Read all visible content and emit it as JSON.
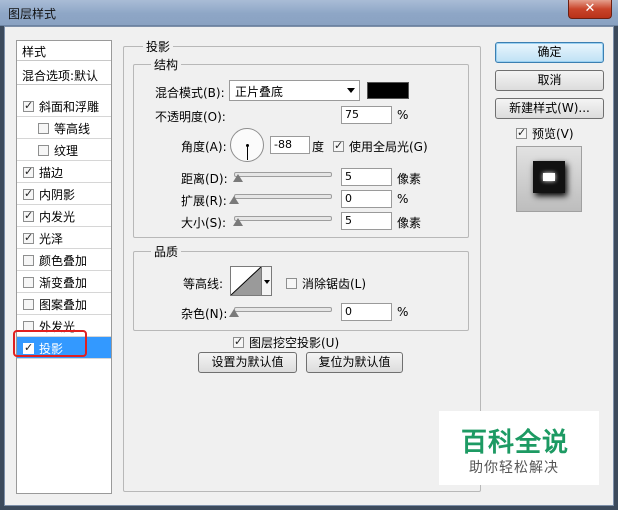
{
  "window": {
    "title": "图层样式",
    "close_label": "✕"
  },
  "style_list": {
    "header": "样式",
    "blend_options": "混合选项:默认",
    "items": [
      {
        "label": "斜面和浮雕",
        "checked": true,
        "sub": false
      },
      {
        "label": "等高线",
        "checked": false,
        "sub": true
      },
      {
        "label": "纹理",
        "checked": false,
        "sub": true
      },
      {
        "label": "描边",
        "checked": true,
        "sub": false
      },
      {
        "label": "内阴影",
        "checked": true,
        "sub": false
      },
      {
        "label": "内发光",
        "checked": true,
        "sub": false
      },
      {
        "label": "光泽",
        "checked": true,
        "sub": false
      },
      {
        "label": "颜色叠加",
        "checked": false,
        "sub": false
      },
      {
        "label": "渐变叠加",
        "checked": false,
        "sub": false
      },
      {
        "label": "图案叠加",
        "checked": false,
        "sub": false
      },
      {
        "label": "外发光",
        "checked": false,
        "sub": false
      },
      {
        "label": "投影",
        "checked": true,
        "sub": false,
        "selected": true
      }
    ]
  },
  "panel": {
    "title": "投影",
    "structure": {
      "title": "结构",
      "blend_mode_label": "混合模式(B):",
      "blend_mode_value": "正片叠底",
      "shadow_color": "#000000",
      "opacity_label": "不透明度(O):",
      "opacity_value": "75",
      "opacity_unit": "%",
      "angle_label": "角度(A):",
      "angle_value": "-88",
      "angle_unit": "度",
      "global_light_label": "使用全局光(G)",
      "global_light_checked": true,
      "distance_label": "距离(D):",
      "distance_value": "5",
      "distance_unit": "像素",
      "spread_label": "扩展(R):",
      "spread_value": "0",
      "spread_unit": "%",
      "size_label": "大小(S):",
      "size_value": "5",
      "size_unit": "像素"
    },
    "quality": {
      "title": "品质",
      "contour_label": "等高线:",
      "antialias_label": "消除锯齿(L)",
      "antialias_checked": false,
      "noise_label": "杂色(N):",
      "noise_value": "0",
      "noise_unit": "%"
    },
    "knockout_label": "图层挖空投影(U)",
    "knockout_checked": true,
    "make_default_label": "设置为默认值",
    "reset_default_label": "复位为默认值"
  },
  "buttons": {
    "ok": "确定",
    "cancel": "取消",
    "new_style": "新建样式(W)...",
    "preview_label": "预览(V)",
    "preview_checked": true
  },
  "watermark": {
    "title": "百科全说",
    "subtitle": "助你轻松解决"
  }
}
